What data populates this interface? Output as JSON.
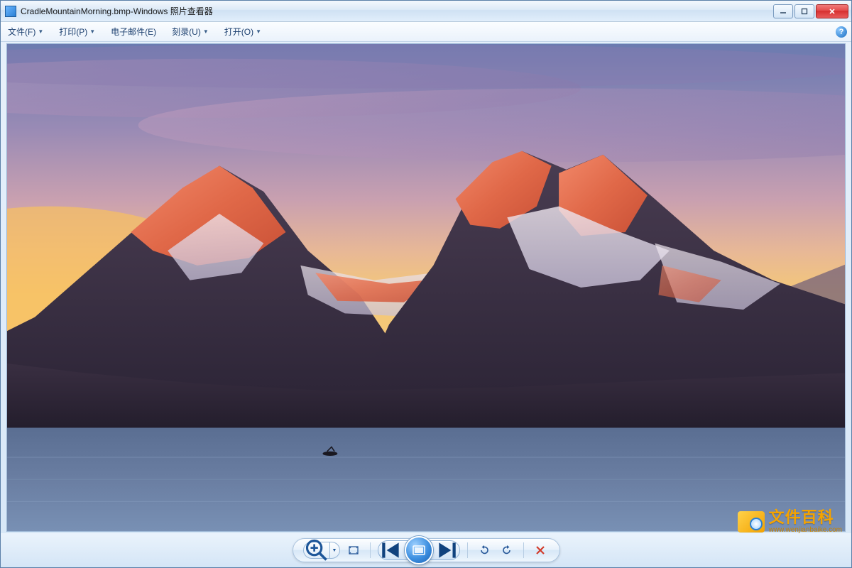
{
  "window": {
    "filename": "CradleMountainMorning.bmp",
    "app_name": "Windows 照片查看器",
    "title_separator": " - "
  },
  "menu": {
    "file": "文件(F)",
    "print": "打印(P)",
    "email": "电子邮件(E)",
    "burn": "刻录(U)",
    "open": "打开(O)"
  },
  "toolbar": {
    "zoom": "zoom",
    "fit": "fit-to-window",
    "prev": "previous",
    "play": "slideshow",
    "next": "next",
    "rotate_ccw": "rotate-left",
    "rotate_cw": "rotate-right",
    "delete": "delete"
  },
  "watermark": {
    "main": "文件百科",
    "sub": "www.wenjianbaike.com"
  },
  "icons": {
    "minimize": "minimize-icon",
    "maximize": "maximize-icon",
    "close": "close-icon",
    "help": "?"
  }
}
